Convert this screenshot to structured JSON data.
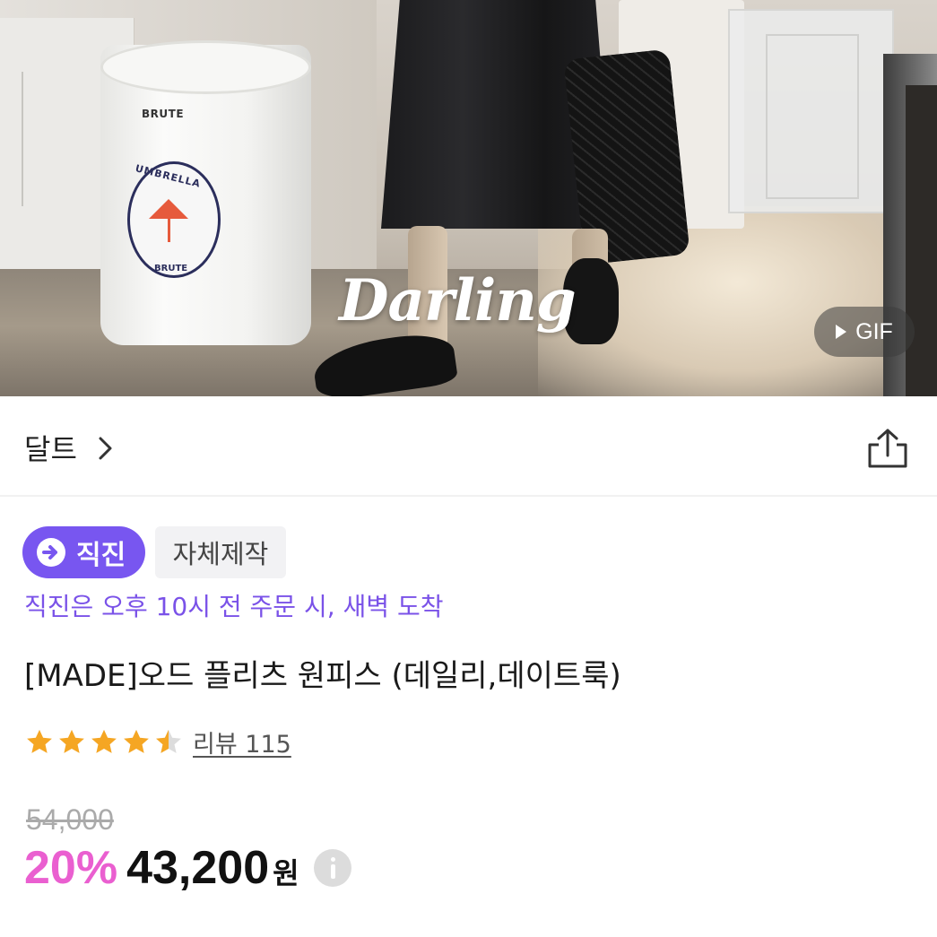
{
  "hero": {
    "overlay_text": "Darling",
    "gif_badge_label": "GIF",
    "bucket_brand": "BRUTE",
    "bucket_badge_word": "UMBRELLA",
    "bucket_badge_brand": "BRUTE"
  },
  "store": {
    "name": "달트",
    "chevron_icon": "chevron-right-icon",
    "share_icon": "share-icon"
  },
  "badges": {
    "jikjin_label": "직진",
    "self_made_label": "자체제작"
  },
  "delivery_note": "직진은 오후 10시 전 주문 시, 새벽 도착",
  "product": {
    "title": "[MADE]오드 플리츠 원피스 (데일리,데이트룩)",
    "rating": 4.5,
    "review_label": "리뷰 115",
    "original_price": "54,000",
    "discount": "20%",
    "sale_price": "43,200",
    "currency": "원"
  },
  "colors": {
    "accent_purple": "#7856f0",
    "delivery_text": "#7a52e8",
    "discount_pink": "#ea5fd0",
    "star_orange": "#f5a623"
  }
}
